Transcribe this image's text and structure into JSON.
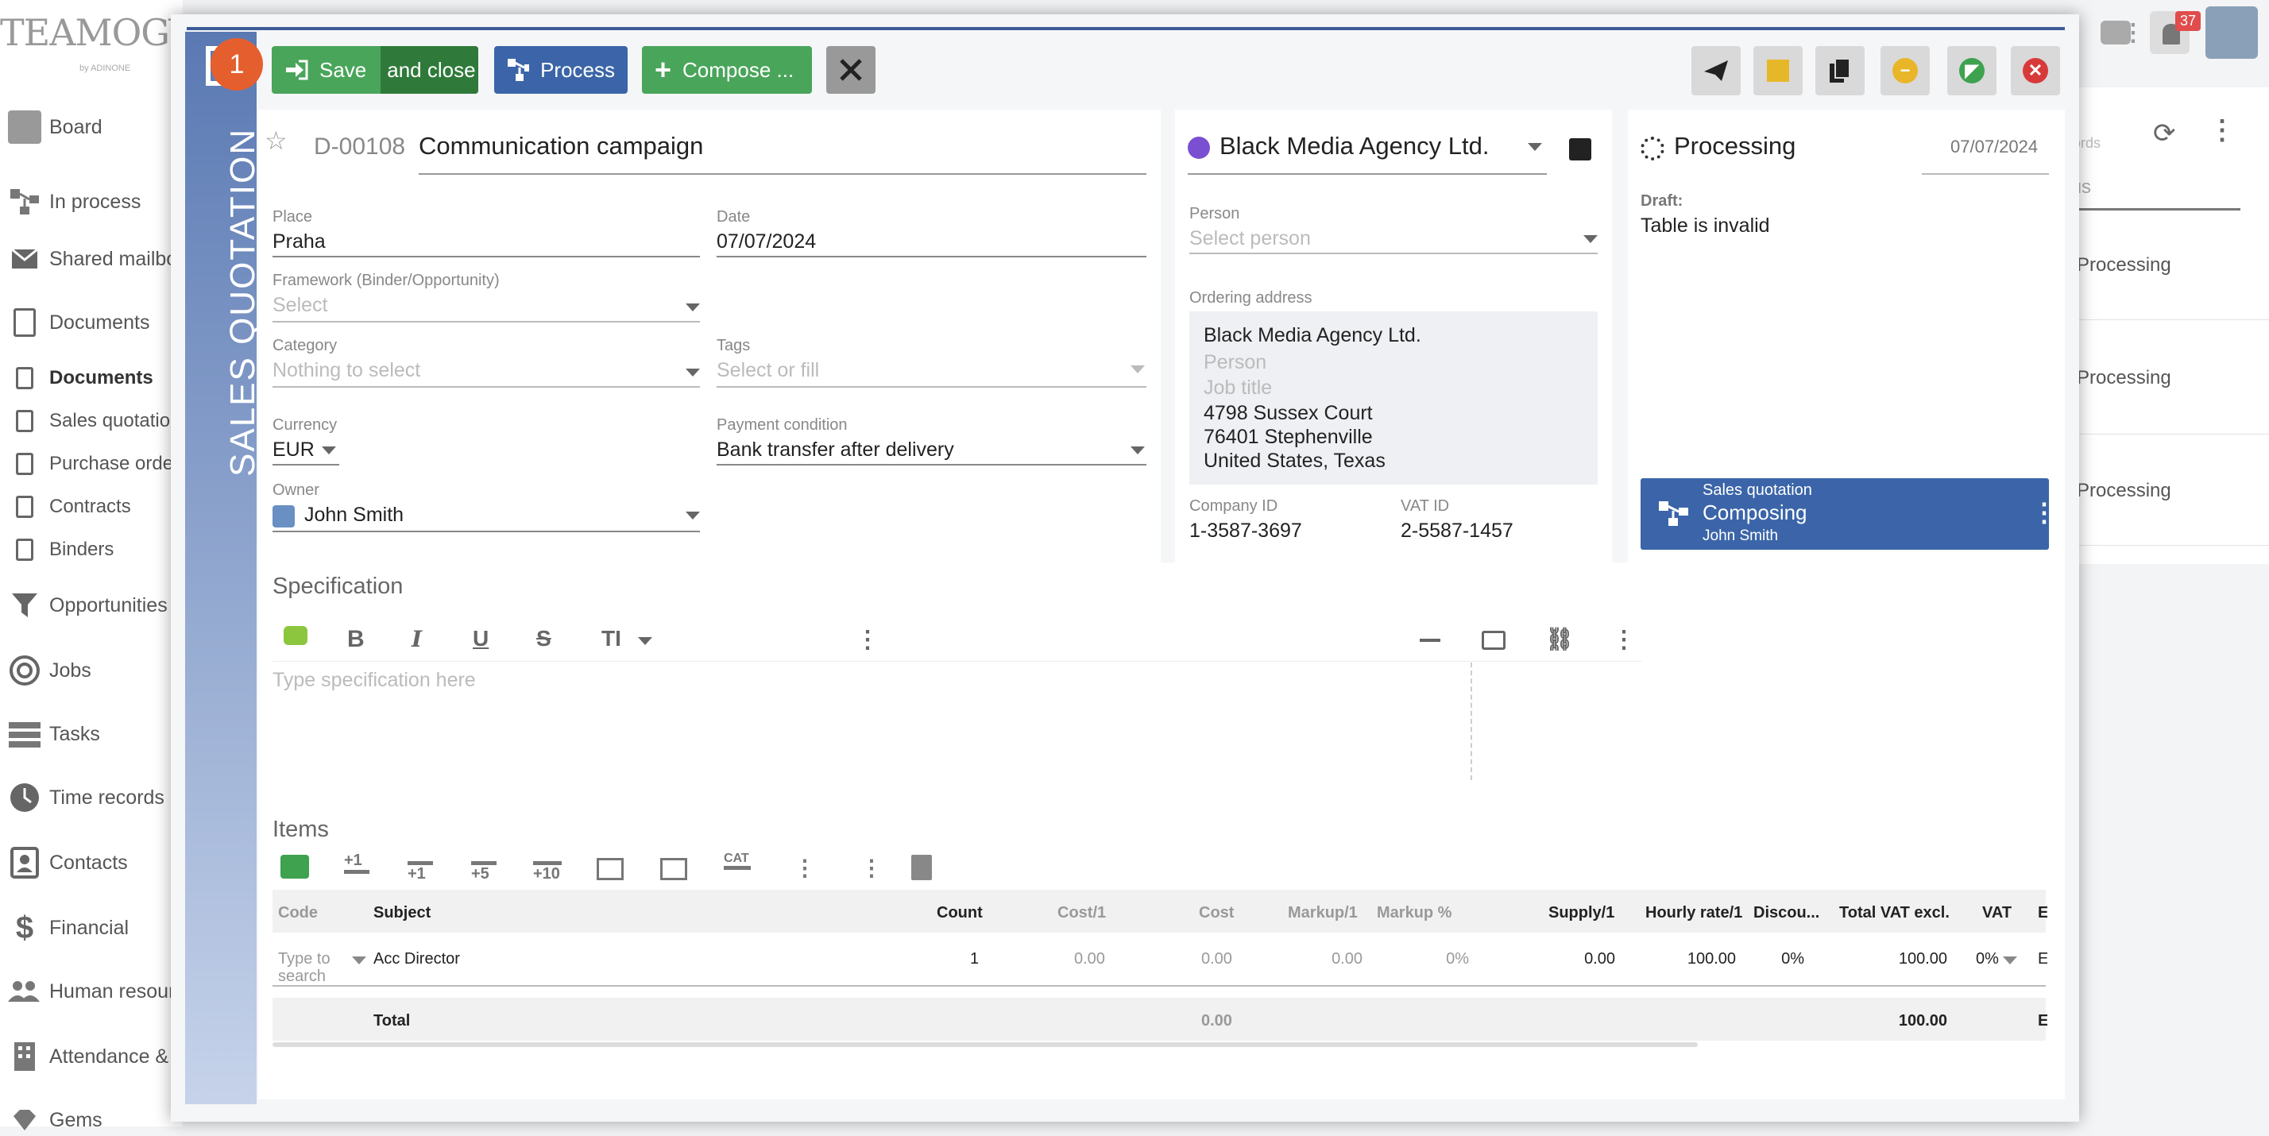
{
  "app": {
    "logo": "TEAMOGY",
    "logo_sub": "by ADINONE",
    "notification_count": "37",
    "nav": [
      {
        "label": "Board",
        "icon": "board-icon"
      },
      {
        "label": "In process",
        "icon": "process-icon"
      },
      {
        "label": "Shared mailbo",
        "icon": "mail-icon"
      },
      {
        "label": "Documents",
        "icon": "document-icon"
      },
      {
        "label": "Documents",
        "icon": "doc-small-icon"
      },
      {
        "label": "Sales quotatio",
        "icon": "doc-small-icon"
      },
      {
        "label": "Purchase orde",
        "icon": "doc-small-icon"
      },
      {
        "label": "Contracts",
        "icon": "doc-small-icon"
      },
      {
        "label": "Binders",
        "icon": "doc-small-icon"
      },
      {
        "label": "Opportunities",
        "icon": "funnel-icon"
      },
      {
        "label": "Jobs",
        "icon": "target-icon"
      },
      {
        "label": "Tasks",
        "icon": "tasks-icon"
      },
      {
        "label": "Time records",
        "icon": "clock-icon"
      },
      {
        "label": "Contacts",
        "icon": "contacts-icon"
      },
      {
        "label": "Financial",
        "icon": "dollar-icon"
      },
      {
        "label": "Human resour",
        "icon": "people-icon"
      },
      {
        "label": "Attendance &",
        "icon": "building-icon"
      },
      {
        "label": "Gems",
        "icon": "gem-icon"
      }
    ],
    "right_list": {
      "col_header_fragment": "cords",
      "filter_fragment": "tus",
      "statuses": [
        "Processing",
        "Processing",
        "Processing"
      ]
    }
  },
  "modal": {
    "ribbon_title": "SALES QUOTATION",
    "step_number": "1",
    "toolbar": {
      "save_label": "Save",
      "save_close_label": "and close",
      "process_label": "Process",
      "compose_label": "Compose ..."
    },
    "header": {
      "doc_id": "D-00108",
      "doc_title": "Communication campaign"
    },
    "fields": {
      "place_label": "Place",
      "place_value": "Praha",
      "date_label": "Date",
      "date_value": "07/07/2024",
      "framework_label": "Framework (Binder/Opportunity)",
      "framework_placeholder": "Select",
      "category_label": "Category",
      "category_placeholder": "Nothing to select",
      "tags_label": "Tags",
      "tags_placeholder": "Select or fill",
      "currency_label": "Currency",
      "currency_value": "EUR",
      "payment_label": "Payment condition",
      "payment_value": "Bank transfer after delivery",
      "owner_label": "Owner",
      "owner_value": "John Smith"
    },
    "company": {
      "name": "Black Media Agency Ltd.",
      "person_label": "Person",
      "person_placeholder": "Select person",
      "address_label": "Ordering address",
      "address_name": "Black Media Agency Ltd.",
      "address_person_placeholder": "Person",
      "address_job_placeholder": "Job title",
      "address_line1": "4798 Sussex Court",
      "address_line2": "76401 Stephenville",
      "address_line3": "United States, Texas",
      "company_id_label": "Company ID",
      "company_id": "1-3587-3697",
      "vat_id_label": "VAT ID",
      "vat_id": "2-5587-1457"
    },
    "status": {
      "title": "Processing",
      "date": "07/07/2024",
      "draft_label": "Draft:",
      "draft_message": "Table is invalid",
      "workflow_type": "Sales quotation",
      "workflow_state": "Composing",
      "workflow_user": "John Smith"
    },
    "specification": {
      "heading": "Specification",
      "placeholder": "Type specification here"
    },
    "items": {
      "heading": "Items",
      "toolbar_labels": [
        "+1",
        "+1",
        "+5",
        "+10",
        "CAT"
      ],
      "columns": [
        "Code",
        "Subject",
        "Count",
        "Cost/1",
        "Cost",
        "Markup/1",
        "Markup %",
        "Supply/1",
        "Hourly rate/1",
        "Discou...",
        "Total VAT excl.",
        "VAT",
        "EU"
      ],
      "row": {
        "code_placeholder": "Type to search",
        "subject": "Acc Director",
        "count": "1",
        "cost1": "0.00",
        "cost": "0.00",
        "markup1": "0.00",
        "markup_pct": "0%",
        "supply1": "0.00",
        "hourly_rate": "100.00",
        "discount": "0%",
        "total": "100.00",
        "vat": "0%",
        "eu": "EU"
      },
      "total_row": {
        "label": "Total",
        "cost": "0.00",
        "total": "100.00",
        "eu": "EU"
      }
    }
  },
  "colors": {
    "accent_blue": "#3b65a8",
    "save_green": "#49a55a",
    "badge_orange": "#e55f2e"
  }
}
